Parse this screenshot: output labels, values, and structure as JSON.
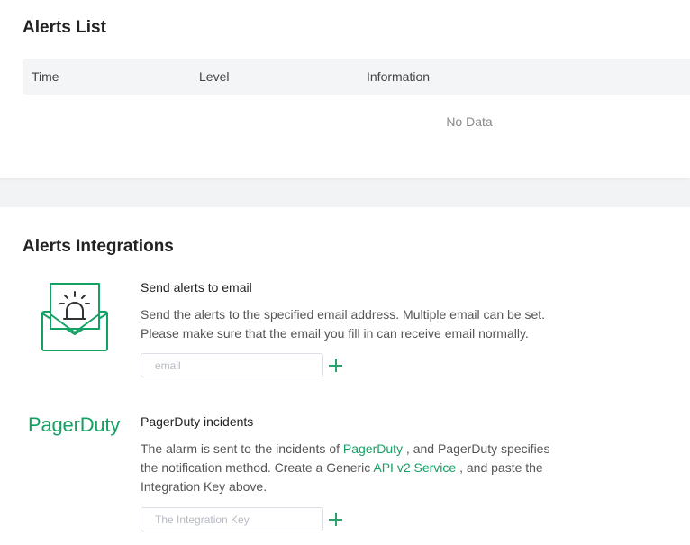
{
  "alerts_list": {
    "title": "Alerts List",
    "columns": [
      "Time",
      "Level",
      "Information"
    ],
    "empty_text": "No Data"
  },
  "alerts_integrations": {
    "title": "Alerts Integrations",
    "email": {
      "icon": "email-alarm-icon",
      "title": "Send alerts to email",
      "description_line1": "Send the alerts to the specified email address. Multiple email can be set.",
      "description_line2": "Please make sure that the email you fill in can receive email normally.",
      "input_placeholder": "email",
      "input_value": ""
    },
    "pagerduty": {
      "logo_text": "PagerDuty",
      "title": "PagerDuty incidents",
      "desc_part1": "The alarm is sent to the incidents of ",
      "desc_link1": "PagerDuty",
      "desc_part2": " , and PagerDuty specifies the notification method. Create a Generic ",
      "desc_link2": "API v2 Service",
      "desc_part3": " , and paste the Integration Key above.",
      "input_placeholder": "The Integration Key",
      "input_value": ""
    }
  },
  "colors": {
    "accent": "#16a164",
    "table_header_bg": "#f4f5f7",
    "page_bg": "#f2f3f5"
  }
}
